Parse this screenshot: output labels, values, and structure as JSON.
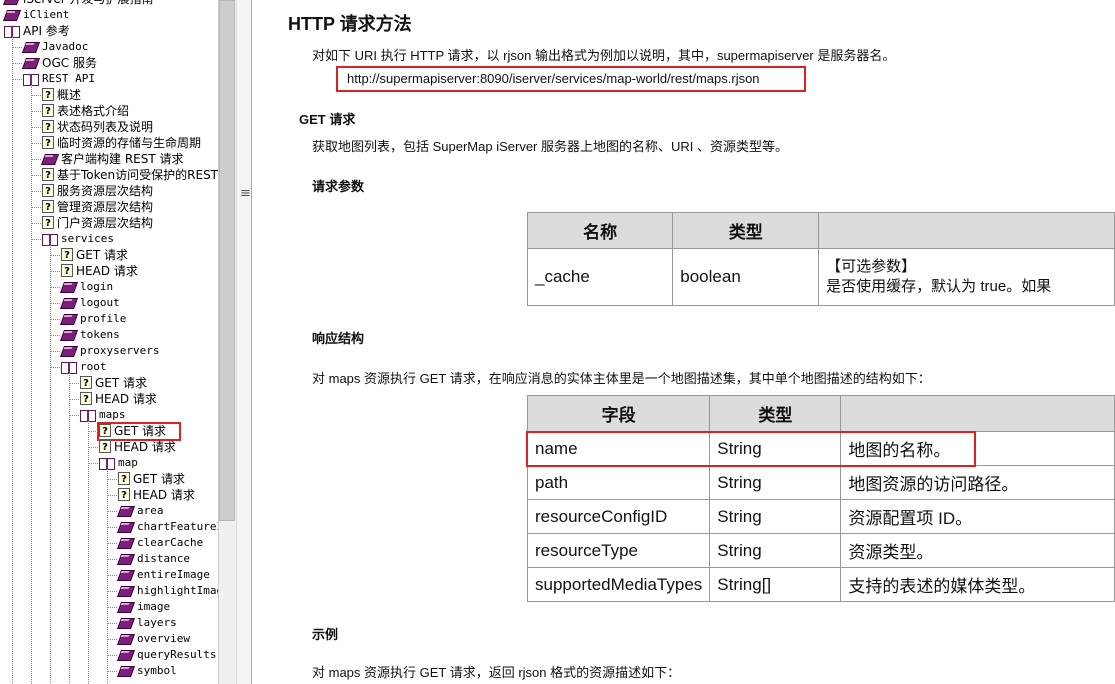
{
  "tree": [
    {
      "label": "iServer 开发与扩展指南",
      "icon": "book",
      "level": 0
    },
    {
      "label": "iClient",
      "icon": "book",
      "level": 0
    },
    {
      "label": "API 参考",
      "icon": "obook",
      "level": 0
    },
    {
      "label": "Javadoc",
      "icon": "book",
      "level": 1
    },
    {
      "label": "OGC 服务",
      "icon": "book",
      "level": 1
    },
    {
      "label": "REST API",
      "icon": "obook",
      "level": 1
    },
    {
      "label": "概述",
      "icon": "q",
      "level": 2
    },
    {
      "label": "表述格式介绍",
      "icon": "q",
      "level": 2
    },
    {
      "label": "状态码列表及说明",
      "icon": "q",
      "level": 2
    },
    {
      "label": "临时资源的存储与生命周期",
      "icon": "q",
      "level": 2
    },
    {
      "label": "客户端构建 REST 请求",
      "icon": "book",
      "level": 2
    },
    {
      "label": "基于Token访问受保护的REST",
      "icon": "q",
      "level": 2
    },
    {
      "label": "服务资源层次结构",
      "icon": "q",
      "level": 2
    },
    {
      "label": "管理资源层次结构",
      "icon": "q",
      "level": 2
    },
    {
      "label": "门户资源层次结构",
      "icon": "q",
      "level": 2
    },
    {
      "label": "services",
      "icon": "obook",
      "level": 2
    },
    {
      "label": "GET 请求",
      "icon": "q",
      "level": 3
    },
    {
      "label": "HEAD 请求",
      "icon": "q",
      "level": 3
    },
    {
      "label": "login",
      "icon": "book",
      "level": 3
    },
    {
      "label": "logout",
      "icon": "book",
      "level": 3
    },
    {
      "label": "profile",
      "icon": "book",
      "level": 3
    },
    {
      "label": "tokens",
      "icon": "book",
      "level": 3
    },
    {
      "label": "proxyservers",
      "icon": "book",
      "level": 3
    },
    {
      "label": "root",
      "icon": "obook",
      "level": 3
    },
    {
      "label": "GET 请求",
      "icon": "q",
      "level": 4
    },
    {
      "label": "HEAD 请求",
      "icon": "q",
      "level": 4
    },
    {
      "label": "maps",
      "icon": "obook",
      "level": 4
    },
    {
      "label": "GET 请求",
      "icon": "q",
      "level": 5,
      "selected": true
    },
    {
      "label": "HEAD 请求",
      "icon": "q",
      "level": 5
    },
    {
      "label": "map",
      "icon": "obook",
      "level": 5
    },
    {
      "label": "GET 请求",
      "icon": "q",
      "level": 6
    },
    {
      "label": "HEAD 请求",
      "icon": "q",
      "level": 6
    },
    {
      "label": "area",
      "icon": "book",
      "level": 6
    },
    {
      "label": "chartFeatureI",
      "icon": "book",
      "level": 6
    },
    {
      "label": "clearCache",
      "icon": "book",
      "level": 6
    },
    {
      "label": "distance",
      "icon": "book",
      "level": 6
    },
    {
      "label": "entireImage",
      "icon": "book",
      "level": 6
    },
    {
      "label": "highlightImag",
      "icon": "book",
      "level": 6
    },
    {
      "label": "image",
      "icon": "book",
      "level": 6
    },
    {
      "label": "layers",
      "icon": "book",
      "level": 6
    },
    {
      "label": "overview",
      "icon": "book",
      "level": 6
    },
    {
      "label": "queryResults",
      "icon": "book",
      "level": 6
    },
    {
      "label": "symbol",
      "icon": "book",
      "level": 6
    }
  ],
  "splitter_grip": "≡",
  "content": {
    "title": "HTTP 请求方法",
    "intro": "对如下 URI 执行 HTTP 请求，以 rjson 输出格式为例加以说明，其中，supermapiserver 是服务器名。",
    "url": "http://supermapiserver:8090/iserver/services/map-world/rest/maps.rjson",
    "get_heading": "GET 请求",
    "get_desc": "获取地图列表，包括 SuperMap iServer 服务器上地图的名称、URI 、资源类型等。",
    "params_heading": "请求参数",
    "params_table": {
      "headers": [
        "名称",
        "类型",
        ""
      ],
      "rows": [
        {
          "name": "_cache",
          "type": "boolean",
          "desc1": "【可选参数】",
          "desc2": "是否使用缓存，默认为 true。如果"
        }
      ]
    },
    "response_heading": "响应结构",
    "response_desc": "对 maps 资源执行 GET 请求，在响应消息的实体主体里是一个地图描述集，其中单个地图描述的结构如下：",
    "fields_table": {
      "headers": [
        "字段",
        "类型",
        ""
      ],
      "rows": [
        {
          "field": "name",
          "type": "String",
          "desc": "地图的名称。"
        },
        {
          "field": "path",
          "type": "String",
          "desc": "地图资源的访问路径。"
        },
        {
          "field": "resourceConfigID",
          "type": "String",
          "desc": "资源配置项 ID。"
        },
        {
          "field": "resourceType",
          "type": "String",
          "desc": "资源类型。"
        },
        {
          "field": "supportedMediaTypes",
          "type": "String[]",
          "desc": "支持的表述的媒体类型。"
        }
      ]
    },
    "example_heading": "示例",
    "example_desc": "对 maps 资源执行 GET 请求，返回 rjson 格式的资源描述如下："
  }
}
